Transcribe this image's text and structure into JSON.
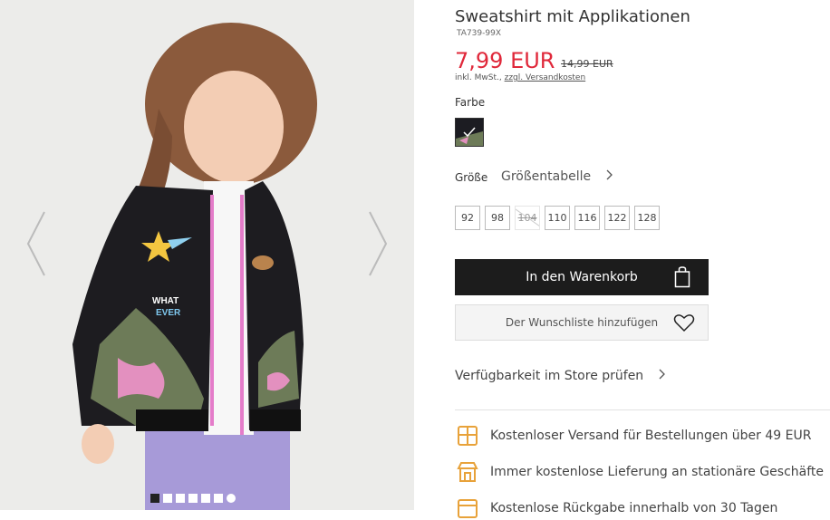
{
  "product": {
    "title": "Sweatshirt mit Applikationen",
    "sku": "TA739-99X",
    "price": "7,99 EUR",
    "old_price": "14,99 EUR",
    "tax_note": "inkl. MwSt.,",
    "shipping_link": "zzgl. Versandkosten"
  },
  "color": {
    "label": "Farbe",
    "swatch_color": "#1c1c22"
  },
  "size": {
    "label": "Größe",
    "guide_link": "Größentabelle",
    "options": [
      {
        "label": "92",
        "available": true
      },
      {
        "label": "98",
        "available": true
      },
      {
        "label": "104",
        "available": false
      },
      {
        "label": "110",
        "available": true
      },
      {
        "label": "116",
        "available": true
      },
      {
        "label": "122",
        "available": true
      },
      {
        "label": "128",
        "available": true
      }
    ]
  },
  "actions": {
    "add_to_cart": "In den Warenkorb",
    "wishlist": "Der Wunschliste hinzufügen",
    "store_check": "Verfügbarkeit im Store prüfen"
  },
  "benefits": [
    {
      "icon": "box-icon",
      "text": "Kostenloser Versand für Bestellungen über 49 EUR"
    },
    {
      "icon": "store-icon",
      "text": "Immer kostenlose Lieferung an stationäre Geschäfte"
    },
    {
      "icon": "calendar-icon",
      "text": "Kostenlose Rückgabe innerhalb von 30 Tagen"
    }
  ],
  "gallery": {
    "total_images": 7,
    "active_index": 0
  },
  "colors": {
    "accent_price": "#e0283a",
    "button_dark": "#1c1c1c",
    "benefit_icon": "#e8a23a"
  }
}
